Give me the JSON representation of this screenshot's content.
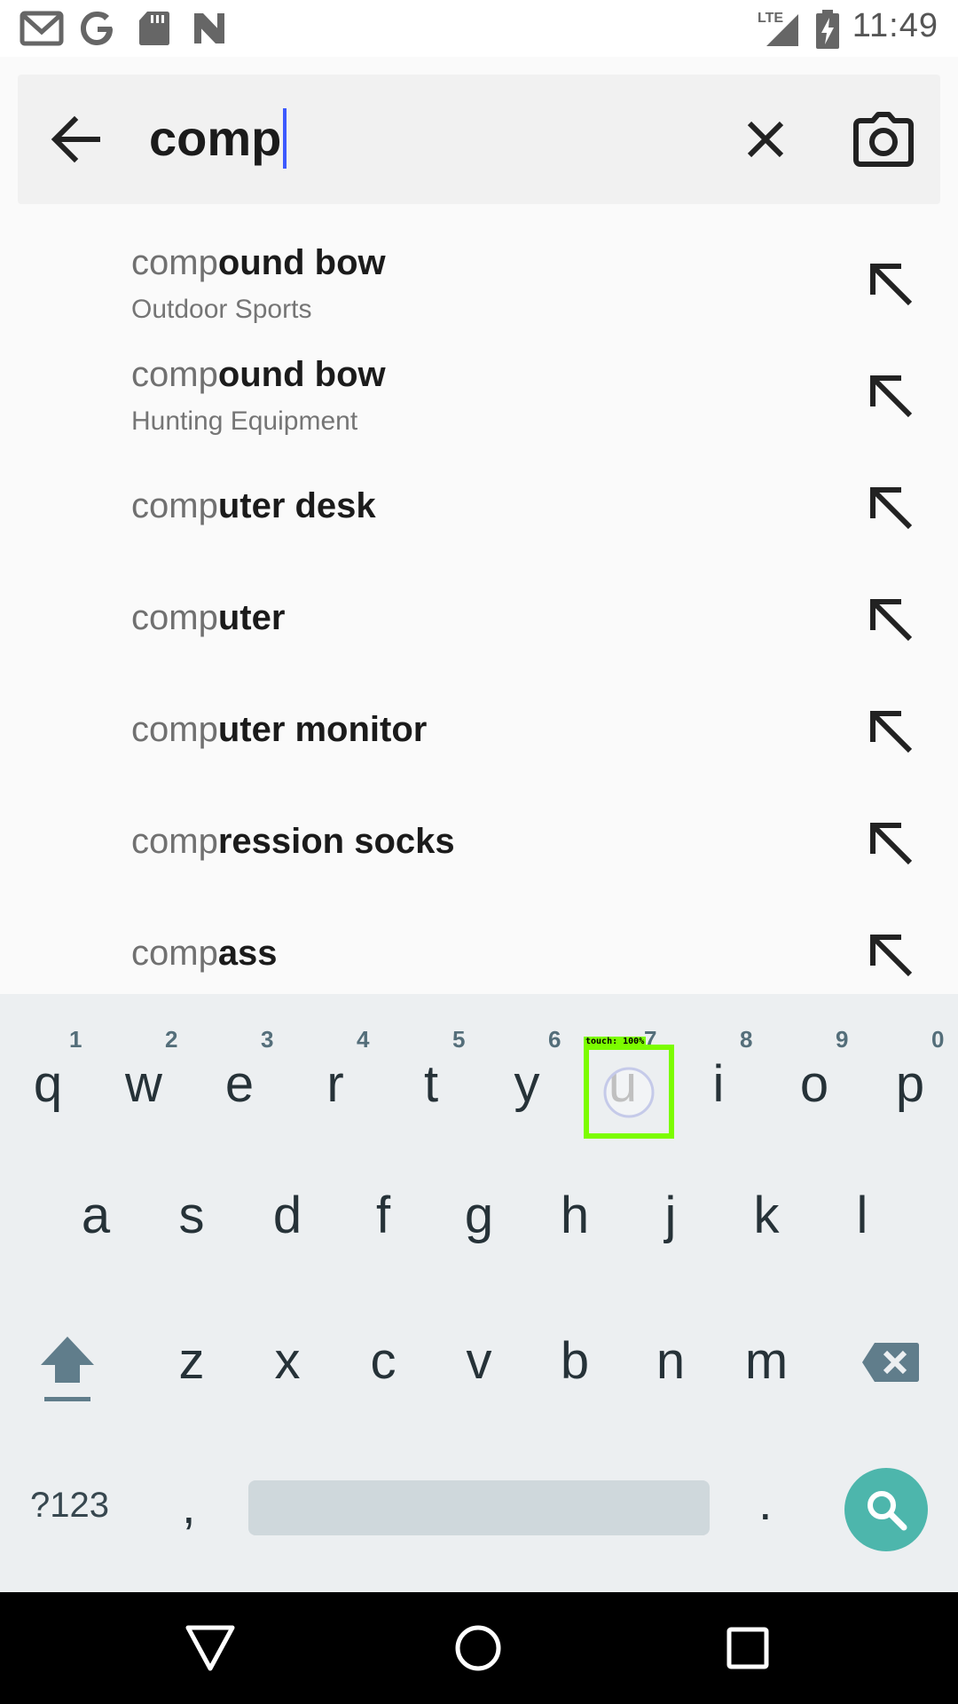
{
  "status_bar": {
    "time": "11:49",
    "network": "LTE",
    "icons": [
      "gmail-icon",
      "google-icon",
      "sd-card-icon",
      "n-icon",
      "signal-icon",
      "battery-charging-icon"
    ]
  },
  "search": {
    "query": "comp",
    "back_icon": "arrow-back-icon",
    "clear_icon": "close-icon",
    "camera_icon": "camera-icon"
  },
  "suggestions": [
    {
      "prefix": "comp",
      "rest": "ound bow",
      "subtitle": "Outdoor Sports"
    },
    {
      "prefix": "comp",
      "rest": "ound bow",
      "subtitle": "Hunting Equipment"
    },
    {
      "prefix": "comp",
      "rest": "uter desk",
      "subtitle": ""
    },
    {
      "prefix": "comp",
      "rest": "uter",
      "subtitle": ""
    },
    {
      "prefix": "comp",
      "rest": "uter monitor",
      "subtitle": ""
    },
    {
      "prefix": "comp",
      "rest": "ression socks",
      "subtitle": ""
    },
    {
      "prefix": "comp",
      "rest": "ass",
      "subtitle": ""
    }
  ],
  "keyboard": {
    "row1": [
      {
        "letter": "q",
        "hint": "1"
      },
      {
        "letter": "w",
        "hint": "2"
      },
      {
        "letter": "e",
        "hint": "3"
      },
      {
        "letter": "r",
        "hint": "4"
      },
      {
        "letter": "t",
        "hint": "5"
      },
      {
        "letter": "y",
        "hint": "6"
      },
      {
        "letter": "u",
        "hint": "7"
      },
      {
        "letter": "i",
        "hint": "8"
      },
      {
        "letter": "o",
        "hint": "9"
      },
      {
        "letter": "p",
        "hint": "0"
      }
    ],
    "row2": [
      "a",
      "s",
      "d",
      "f",
      "g",
      "h",
      "j",
      "k",
      "l"
    ],
    "row3": [
      "z",
      "x",
      "c",
      "v",
      "b",
      "n",
      "m"
    ],
    "symbols_label": "?123",
    "comma": ",",
    "period": ".",
    "touch_label": "touch: 100%",
    "accent_color": "#4db6ac",
    "touch_color": "#7cfc00"
  },
  "nav": {
    "back_icon": "nav-back-icon",
    "home_icon": "nav-home-icon",
    "recents_icon": "nav-recents-icon"
  }
}
